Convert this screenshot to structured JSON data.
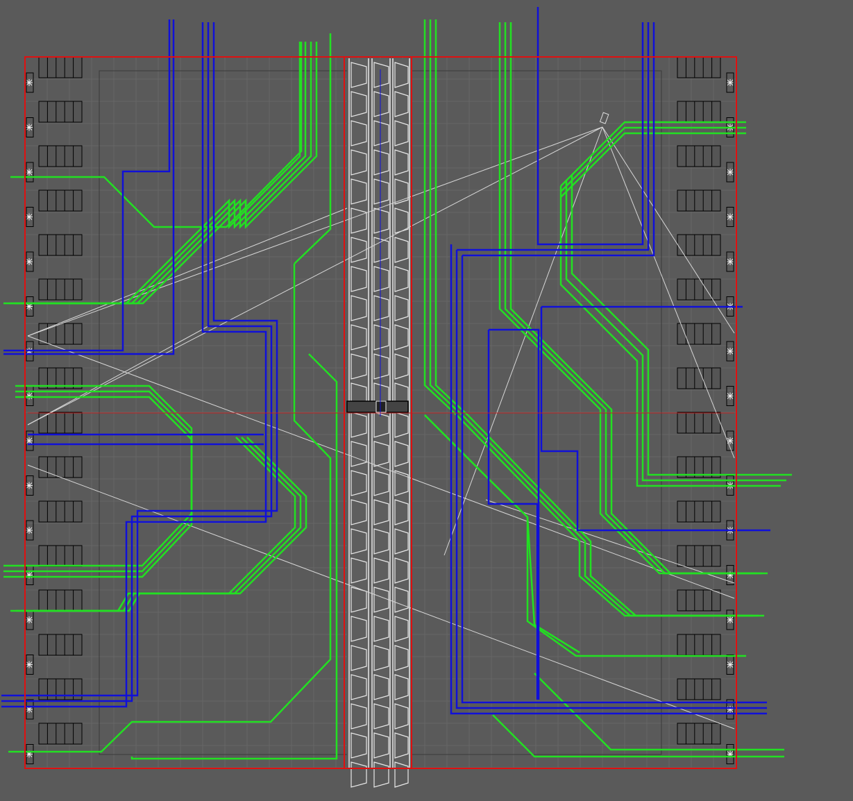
{
  "viewport": {
    "description_free": true
  },
  "colors": {
    "background": "#5a5a5a",
    "grid": "#666666",
    "boundary": "#e01010",
    "road_outline": "#000000",
    "block_fill": "#555555",
    "wire_green": "#22e022",
    "wire_blue": "#1010d8",
    "ray_white": "#d8d8d8",
    "center_strip": "#e8e8e8"
  },
  "icons": {
    "slot_marker": "asterisk-marker-icon",
    "camera": "camera-gizmo-icon"
  }
}
